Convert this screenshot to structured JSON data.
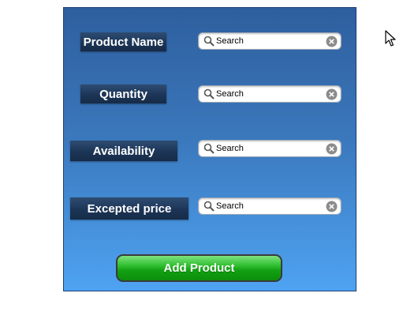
{
  "form": {
    "fields": [
      {
        "label": "Product Name",
        "search_placeholder": "Search",
        "search_icon": "search-icon",
        "clear_icon": "clear-icon"
      },
      {
        "label": "Quantity",
        "search_placeholder": "Search",
        "search_icon": "search-icon",
        "clear_icon": "clear-icon"
      },
      {
        "label": "Availability",
        "search_placeholder": "Search",
        "search_icon": "search-icon",
        "clear_icon": "clear-icon"
      },
      {
        "label": "Excepted price",
        "search_placeholder": "Search",
        "search_icon": "search-icon",
        "clear_icon": "clear-icon"
      }
    ],
    "submit_label": "Add Product"
  },
  "colors": {
    "panel_top": "#2e5f9e",
    "panel_bottom": "#4ea3f2",
    "label_background": "#1c3557",
    "button_green": "#12a012",
    "button_border": "#3a3a3a"
  },
  "icons": {
    "search": "magnifier-icon",
    "clear": "circled-x-icon",
    "pointer": "mouse-cursor-icon"
  }
}
